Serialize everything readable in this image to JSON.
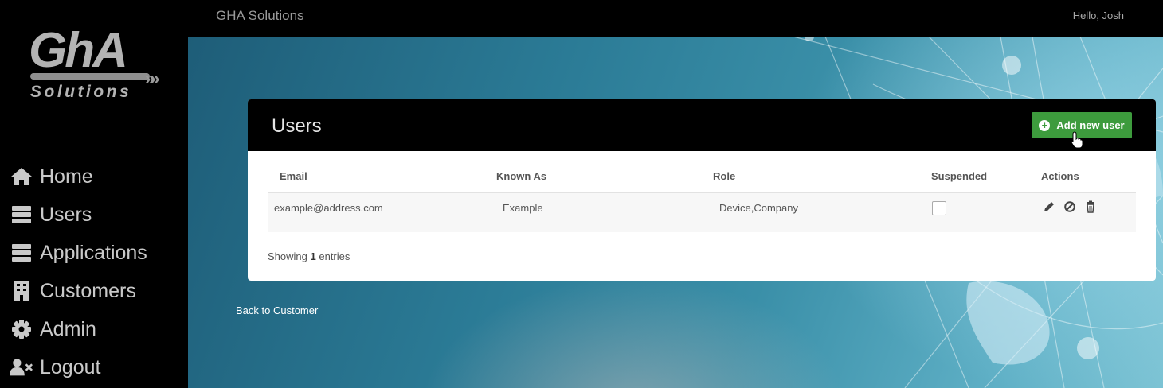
{
  "app": {
    "brand": "GHA Solutions",
    "greeting": "Hello, Josh",
    "logo_main": "GhA",
    "logo_sub": "Solutions"
  },
  "sidebar": {
    "items": [
      {
        "label": "Home",
        "icon": "home-icon"
      },
      {
        "label": "Users",
        "icon": "server-icon"
      },
      {
        "label": "Applications",
        "icon": "server-icon"
      },
      {
        "label": "Customers",
        "icon": "building-icon"
      },
      {
        "label": "Admin",
        "icon": "gear-icon"
      },
      {
        "label": "Logout",
        "icon": "user-times-icon"
      }
    ]
  },
  "panel": {
    "title": "Users",
    "add_button": "Add new user",
    "columns": [
      "Email",
      "Known As",
      "Role",
      "Suspended",
      "Actions"
    ],
    "rows": [
      {
        "email": "example@address.com",
        "known_as": "Example",
        "role": "Device,Company",
        "suspended": false
      }
    ],
    "showing_prefix": "Showing",
    "showing_count": "1",
    "showing_suffix": "entries"
  },
  "back_link": "Back to Customer",
  "colors": {
    "accent_green": "#3d9b3d",
    "sidebar_bg": "#000000",
    "nav_text": "#c9c9c9"
  }
}
